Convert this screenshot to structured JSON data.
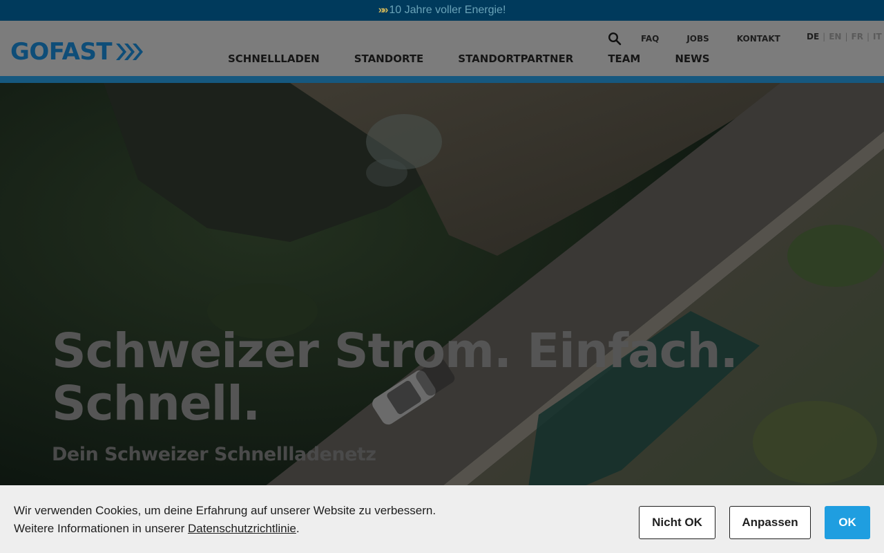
{
  "topbar": {
    "icon": "double-chevron-icon",
    "text": "10 Jahre voller Energie!"
  },
  "header": {
    "logo": "GOFAST",
    "util_nav": [
      "FAQ",
      "JOBS",
      "KONTAKT"
    ],
    "languages": [
      "DE",
      "EN",
      "FR",
      "IT"
    ],
    "active_language": "DE",
    "main_nav": [
      "SCHNELLLADEN",
      "STANDORTE",
      "STANDORTPARTNER",
      "TEAM",
      "NEWS"
    ]
  },
  "hero": {
    "title_line1": "Schweizer Strom. Einfach.",
    "title_line2": "Schnell.",
    "subtitle": "Dein Schweizer Schnellladenetz"
  },
  "cookie": {
    "line1": "Wir verwenden Cookies, um deine Erfahrung auf unserer Website zu verbessern.",
    "line2_prefix": "Weitere Informationen in unserer",
    "line2_link": "Datenschutzrichtlinie",
    "line2_suffix": ".",
    "buttons": {
      "reject": "Nicht OK",
      "customize": "Anpassen",
      "accept": "OK"
    }
  },
  "colors": {
    "brand_blue": "#0e4d78",
    "accent_blue": "#1f9ee0",
    "topbar": "#003a5c"
  }
}
